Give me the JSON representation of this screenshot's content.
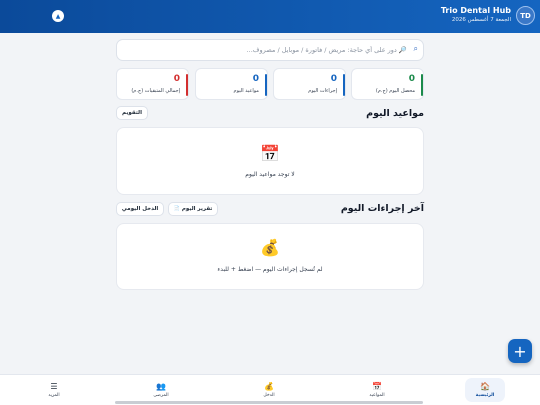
{
  "header": {
    "app_name": "Trio Dental Hub",
    "date": "الجمعة 7 أغسطس 2026",
    "avatar": "TD",
    "collapse_icon": "chevron-up-icon"
  },
  "search": {
    "placeholder": "🔎 دور على أي حاجة: مريض / فاتورة / موبايل / مصروف..."
  },
  "stats": [
    {
      "value": "0",
      "label": "محصل اليوم (ج.م)",
      "color": "#1b8a4b"
    },
    {
      "value": "0",
      "label": "إجراءات اليوم",
      "color": "#1565c0"
    },
    {
      "value": "0",
      "label": "مواعيد اليوم",
      "color": "#1565c0"
    },
    {
      "value": "0",
      "label": "إجمالي المتبقيات (ج.م)",
      "color": "#d32f2f"
    }
  ],
  "appointments": {
    "title": "مواعيد اليوم",
    "calendar_button": "التقويم",
    "empty_icon": "📅",
    "empty_text": "لا توجد مواعيد اليوم"
  },
  "procedures": {
    "title": "آخر إجراءات اليوم",
    "report_button": "تقرير اليوم",
    "report_icon": "📄",
    "income_button": "الدخل اليومي",
    "empty_icon": "💰",
    "empty_text": "لم تُسجل إجراءات اليوم — اضغط + للبدء"
  },
  "fab": {
    "label": "+"
  },
  "nav": [
    {
      "label": "الرئيسية",
      "icon": "🏠",
      "active": true
    },
    {
      "label": "المواعيد",
      "icon": "📅",
      "active": false
    },
    {
      "label": "الدخل",
      "icon": "💰",
      "active": false
    },
    {
      "label": "المرضى",
      "icon": "👥",
      "active": false
    },
    {
      "label": "المزيد",
      "icon": "☰",
      "active": false
    }
  ],
  "colors": {
    "primary": "#1565c0",
    "header_dark": "#0b4a9a",
    "green": "#1b8a4b",
    "red": "#d32f2f",
    "background": "#f2f4f7"
  }
}
